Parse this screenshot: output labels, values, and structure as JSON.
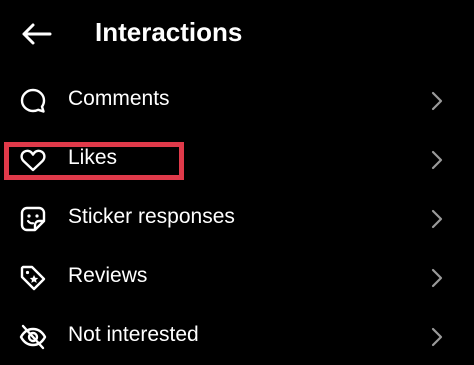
{
  "header": {
    "title": "Interactions",
    "back_icon": "arrow-left-icon"
  },
  "menu": {
    "items": [
      {
        "label": "Comments",
        "icon": "comment-bubble-icon"
      },
      {
        "label": "Likes",
        "icon": "heart-icon"
      },
      {
        "label": "Sticker responses",
        "icon": "sticker-icon"
      },
      {
        "label": "Reviews",
        "icon": "tag-star-icon"
      },
      {
        "label": "Not interested",
        "icon": "eye-off-icon"
      }
    ],
    "chevron_icon": "chevron-right-icon"
  },
  "annotation": {
    "highlight_color": "#e03a4a",
    "highlighted_item": "Likes"
  },
  "colors": {
    "background": "#000000",
    "text": "#ffffff",
    "chevron": "#9a9a9a"
  }
}
